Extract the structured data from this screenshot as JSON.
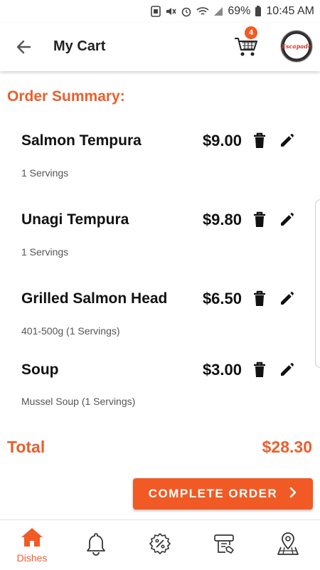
{
  "status_bar": {
    "battery": "69%",
    "time": "10:45 AM"
  },
  "header": {
    "title": "My Cart",
    "cart_count": "4",
    "logo_text": "Escapade"
  },
  "section_title": "Order Summary:",
  "items": [
    {
      "name": "Salmon Tempura",
      "price": "$9.00",
      "detail": "1 Servings"
    },
    {
      "name": "Unagi Tempura",
      "price": "$9.80",
      "detail": "1 Servings"
    },
    {
      "name": "Grilled Salmon Head",
      "price": "$6.50",
      "detail": "401-500g (1 Servings)"
    },
    {
      "name": "Soup",
      "price": "$3.00",
      "detail": "Mussel Soup (1 Servings)"
    }
  ],
  "total": {
    "label": "Total",
    "value": "$28.30"
  },
  "complete_button": {
    "label": "COMPLETE ORDER"
  },
  "bottom_nav": [
    {
      "label": "Dishes",
      "icon": "home-icon",
      "active": true
    },
    {
      "label": "",
      "icon": "bell-icon",
      "active": false
    },
    {
      "label": "",
      "icon": "discount-icon",
      "active": false
    },
    {
      "label": "",
      "icon": "bill-icon",
      "active": false
    },
    {
      "label": "",
      "icon": "map-pin-icon",
      "active": false
    }
  ],
  "colors": {
    "accent": "#f15a24",
    "accent_text": "#e8602c"
  }
}
